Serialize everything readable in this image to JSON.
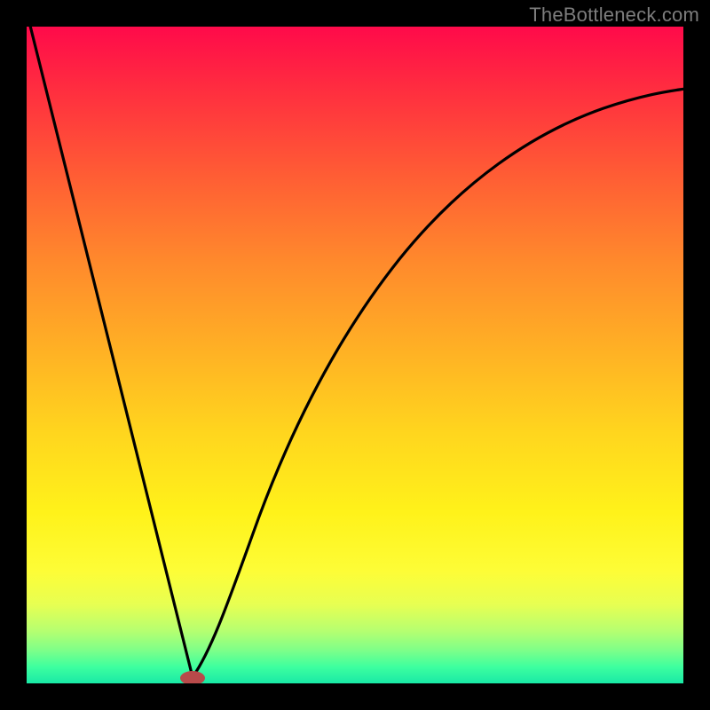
{
  "watermark": "TheBottleneck.com",
  "chart_data": {
    "type": "line",
    "title": "",
    "xlabel": "",
    "ylabel": "",
    "xlim": [
      0,
      100
    ],
    "ylim": [
      0,
      100
    ],
    "series": [
      {
        "name": "left-branch",
        "x": [
          0,
          5,
          10,
          15,
          20,
          23,
          25
        ],
        "values": [
          100,
          80,
          60,
          40,
          20,
          8,
          0
        ]
      },
      {
        "name": "right-branch",
        "x": [
          25,
          27,
          30,
          35,
          40,
          45,
          50,
          55,
          60,
          65,
          70,
          75,
          80,
          85,
          90,
          95,
          100
        ],
        "values": [
          0,
          8,
          20,
          36,
          48,
          57,
          64,
          70,
          74.5,
          78,
          81,
          83.5,
          85.5,
          87,
          88.3,
          89.3,
          90
        ]
      }
    ],
    "marker": {
      "name": "bottleneck-point",
      "x": 25,
      "y": 0
    },
    "grid": false,
    "legend": false
  },
  "colors": {
    "frame": "#000000",
    "curve": "#000000",
    "marker": "#b84a4a",
    "gradient_top": "#ff0a4a",
    "gradient_bottom": "#19e9a6"
  }
}
